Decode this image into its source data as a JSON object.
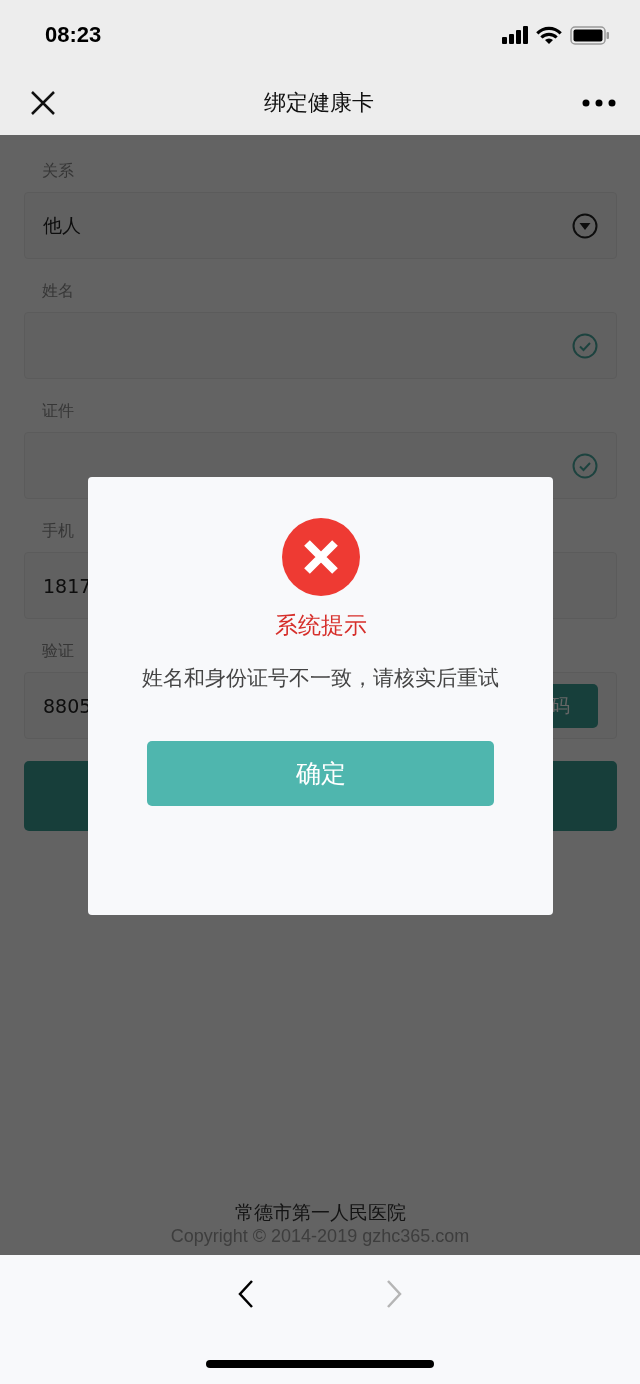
{
  "status_bar": {
    "time": "08:23"
  },
  "nav": {
    "title": "绑定健康卡"
  },
  "form": {
    "fields": [
      {
        "kind": "select",
        "label": "关系",
        "value": "他人"
      },
      {
        "kind": "verified",
        "label": "姓名"
      },
      {
        "kind": "verified",
        "label": "证件"
      },
      {
        "kind": "text",
        "label": "手机",
        "value": "1817"
      },
      {
        "kind": "code",
        "label": "验证",
        "value": "8805",
        "button": "码"
      }
    ]
  },
  "footer": {
    "hospital": "常德市第一人民医院",
    "copyright": "Copyright © 2014-2019 gzhc365.com"
  },
  "dialog": {
    "title": "系统提示",
    "message": "姓名和身份证号不一致，请核实后重试",
    "button": "确定"
  },
  "browser_bar": {
    "back_disabled": false,
    "forward_disabled": true
  }
}
